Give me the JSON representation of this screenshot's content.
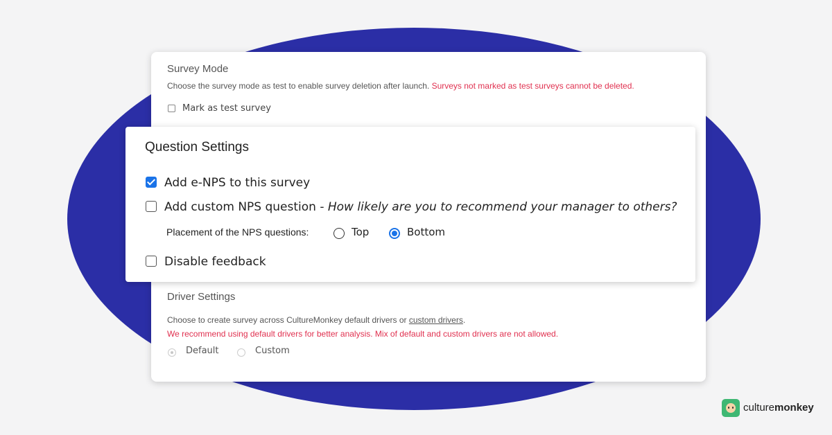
{
  "survey_mode": {
    "title": "Survey Mode",
    "description": "Choose the survey mode as test to enable survey deletion after launch.",
    "warning": "Surveys not marked as test surveys cannot be deleted.",
    "test_checkbox_label": "Mark as test survey",
    "test_checked": false
  },
  "question_settings": {
    "title": "Question Settings",
    "enps_label": "Add e-NPS to this survey",
    "enps_checked": true,
    "custom_nps_label": "Add custom NPS question - ",
    "custom_nps_question": "How likely are you to recommend your manager to others?",
    "custom_nps_checked": false,
    "placement_label": "Placement of the NPS questions:",
    "placement_options": [
      "Top",
      "Bottom"
    ],
    "placement_selected": "Bottom",
    "disable_feedback_label": "Disable feedback",
    "disable_feedback_checked": false
  },
  "driver_settings": {
    "title": "Driver Settings",
    "description_prefix": "Choose to create survey across CultureMonkey default drivers or ",
    "description_link": "custom drivers",
    "description_suffix": ".",
    "warning": "We recommend using default drivers for better analysis. Mix of default and custom drivers are not allowed.",
    "options": [
      "Default",
      "Custom"
    ],
    "selected": "Default"
  },
  "brand": {
    "name_light": "culture",
    "name_bold": "monkey",
    "logo_icon": "monkey-face-icon"
  },
  "colors": {
    "blob": "#2b2ea6",
    "accent": "#1a73e8",
    "warning": "#e0304f",
    "logo": "#3fb773"
  }
}
